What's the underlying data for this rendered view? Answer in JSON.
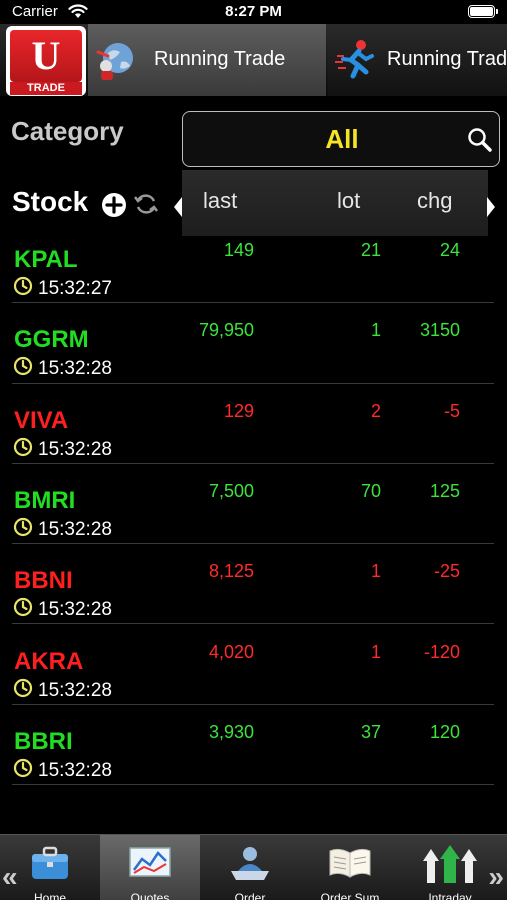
{
  "status_bar": {
    "carrier": "Carrier",
    "time": "8:27 PM"
  },
  "app": {
    "logo_letter": "U",
    "logo_text": "TRADE"
  },
  "tabs": [
    {
      "label": "Running Trade",
      "active": true,
      "icon": "globe-person-icon"
    },
    {
      "label": "Running Trade",
      "active": false,
      "icon": "runner-icon"
    }
  ],
  "category": {
    "label": "Category",
    "value": "All"
  },
  "table": {
    "stock_header": "Stock",
    "columns": [
      "last",
      "lot",
      "chg"
    ],
    "rows": [
      {
        "code": "KPAL",
        "time": "15:32:27",
        "last": "149",
        "lot": "21",
        "chg": "24",
        "direction": "up"
      },
      {
        "code": "GGRM",
        "time": "15:32:28",
        "last": "79,950",
        "lot": "1",
        "chg": "3150",
        "direction": "up"
      },
      {
        "code": "VIVA",
        "time": "15:32:28",
        "last": "129",
        "lot": "2",
        "chg": "-5",
        "direction": "down"
      },
      {
        "code": "BMRI",
        "time": "15:32:28",
        "last": "7,500",
        "lot": "70",
        "chg": "125",
        "direction": "up"
      },
      {
        "code": "BBNI",
        "time": "15:32:28",
        "last": "8,125",
        "lot": "1",
        "chg": "-25",
        "direction": "down"
      },
      {
        "code": "AKRA",
        "time": "15:32:28",
        "last": "4,020",
        "lot": "1",
        "chg": "-120",
        "direction": "down"
      },
      {
        "code": "BBRI",
        "time": "15:32:28",
        "last": "3,930",
        "lot": "37",
        "chg": "120",
        "direction": "up"
      }
    ]
  },
  "bottom_nav": [
    {
      "label": "Home",
      "icon": "briefcase-icon",
      "active": false
    },
    {
      "label": "Quotes",
      "icon": "chart-icon",
      "active": true
    },
    {
      "label": "Order",
      "icon": "person-desk-icon",
      "active": false
    },
    {
      "label": "Order Sum",
      "icon": "book-icon",
      "active": false
    },
    {
      "label": "Intraday",
      "icon": "arrows-up-icon",
      "active": false
    }
  ],
  "colors": {
    "up": "#3be33b",
    "down": "#ff2a2a",
    "category_value": "#f7e326"
  }
}
